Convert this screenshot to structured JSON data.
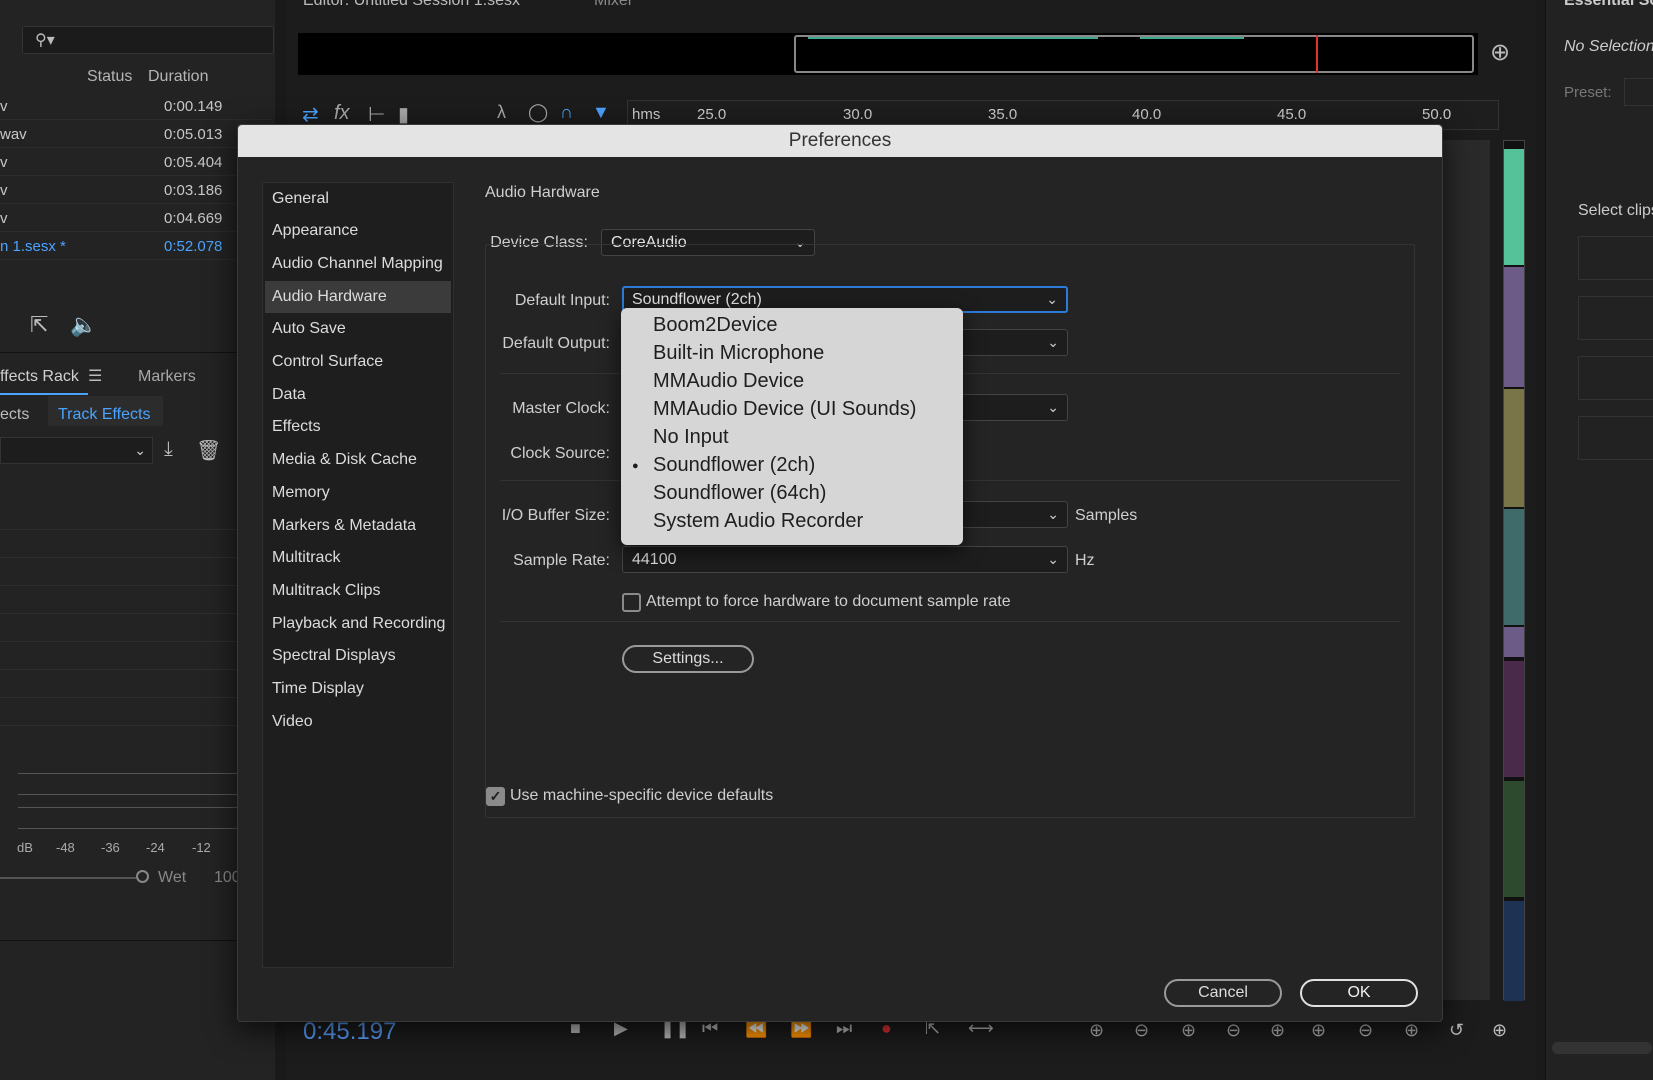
{
  "editor_header": {
    "tab_title": "Editor: Untitled Session 1.sesx",
    "mixer_tab": "Mixer"
  },
  "files_panel": {
    "columns": [
      "Status",
      "Duration"
    ],
    "rows": [
      {
        "name": "v",
        "duration": "0:00.149"
      },
      {
        "name": "wav",
        "duration": "0:05.013"
      },
      {
        "name": "v",
        "duration": "0:05.404"
      },
      {
        "name": "v",
        "duration": "0:03.186"
      },
      {
        "name": "v",
        "duration": "0:04.669"
      },
      {
        "name": "n 1.sesx *",
        "duration": "0:52.078"
      }
    ]
  },
  "effects_panel": {
    "rack_tab": "ffects Rack",
    "markers_tab": "Markers",
    "clip_effects_tab": "ects",
    "track_effects_tab": "Track Effects",
    "meter_labels": [
      "dB",
      "-48",
      "-36",
      "-24",
      "-12"
    ],
    "wet_label": "Wet",
    "wet_value": "100"
  },
  "timeline": {
    "ruler_labels": [
      "hms",
      "25.0",
      "30.0",
      "35.0",
      "40.0",
      "45.0",
      "50.0"
    ],
    "current_time": "0:45.197"
  },
  "right_panel": {
    "title": "Essential So",
    "no_selection": "No Selection",
    "preset_label": "Preset:",
    "select_clips": "Select clips"
  },
  "dialog": {
    "title": "Preferences",
    "categories": [
      "General",
      "Appearance",
      "Audio Channel Mapping",
      "Audio Hardware",
      "Auto Save",
      "Control Surface",
      "Data",
      "Effects",
      "Media & Disk Cache",
      "Memory",
      "Markers & Metadata",
      "Multitrack",
      "Multitrack Clips",
      "Playback and Recording",
      "Spectral Displays",
      "Time Display",
      "Video"
    ],
    "selected_category": "Audio Hardware",
    "section_title": "Audio Hardware",
    "device_class_label": "Device Class:",
    "device_class_value": "CoreAudio",
    "default_input_label": "Default Input:",
    "default_input_value": "Soundflower (2ch)",
    "default_output_label": "Default Output:",
    "master_clock_label": "Master Clock:",
    "clock_source_label": "Clock Source:",
    "buffer_label": "I/O Buffer Size:",
    "buffer_unit": "Samples",
    "sample_rate_label": "Sample Rate:",
    "sample_rate_value": "44100",
    "sample_rate_unit": "Hz",
    "force_rate_label": "Attempt to force hardware to document sample rate",
    "force_rate_checked": false,
    "settings_button": "Settings...",
    "machine_defaults_label": "Use machine-specific device defaults",
    "machine_defaults_checked": true,
    "cancel_button": "Cancel",
    "ok_button": "OK"
  },
  "input_dropdown": {
    "options": [
      "Boom2Device",
      "Built-in Microphone",
      "MMAudio Device",
      "MMAudio Device (UI Sounds)",
      "No Input",
      "Soundflower (2ch)",
      "Soundflower (64ch)",
      "System Audio Recorder"
    ],
    "selected": "Soundflower (2ch)"
  },
  "colors": {
    "accent_blue": "#2d7bd9",
    "link_blue": "#4ba3ff",
    "record_red": "#e0322f"
  }
}
